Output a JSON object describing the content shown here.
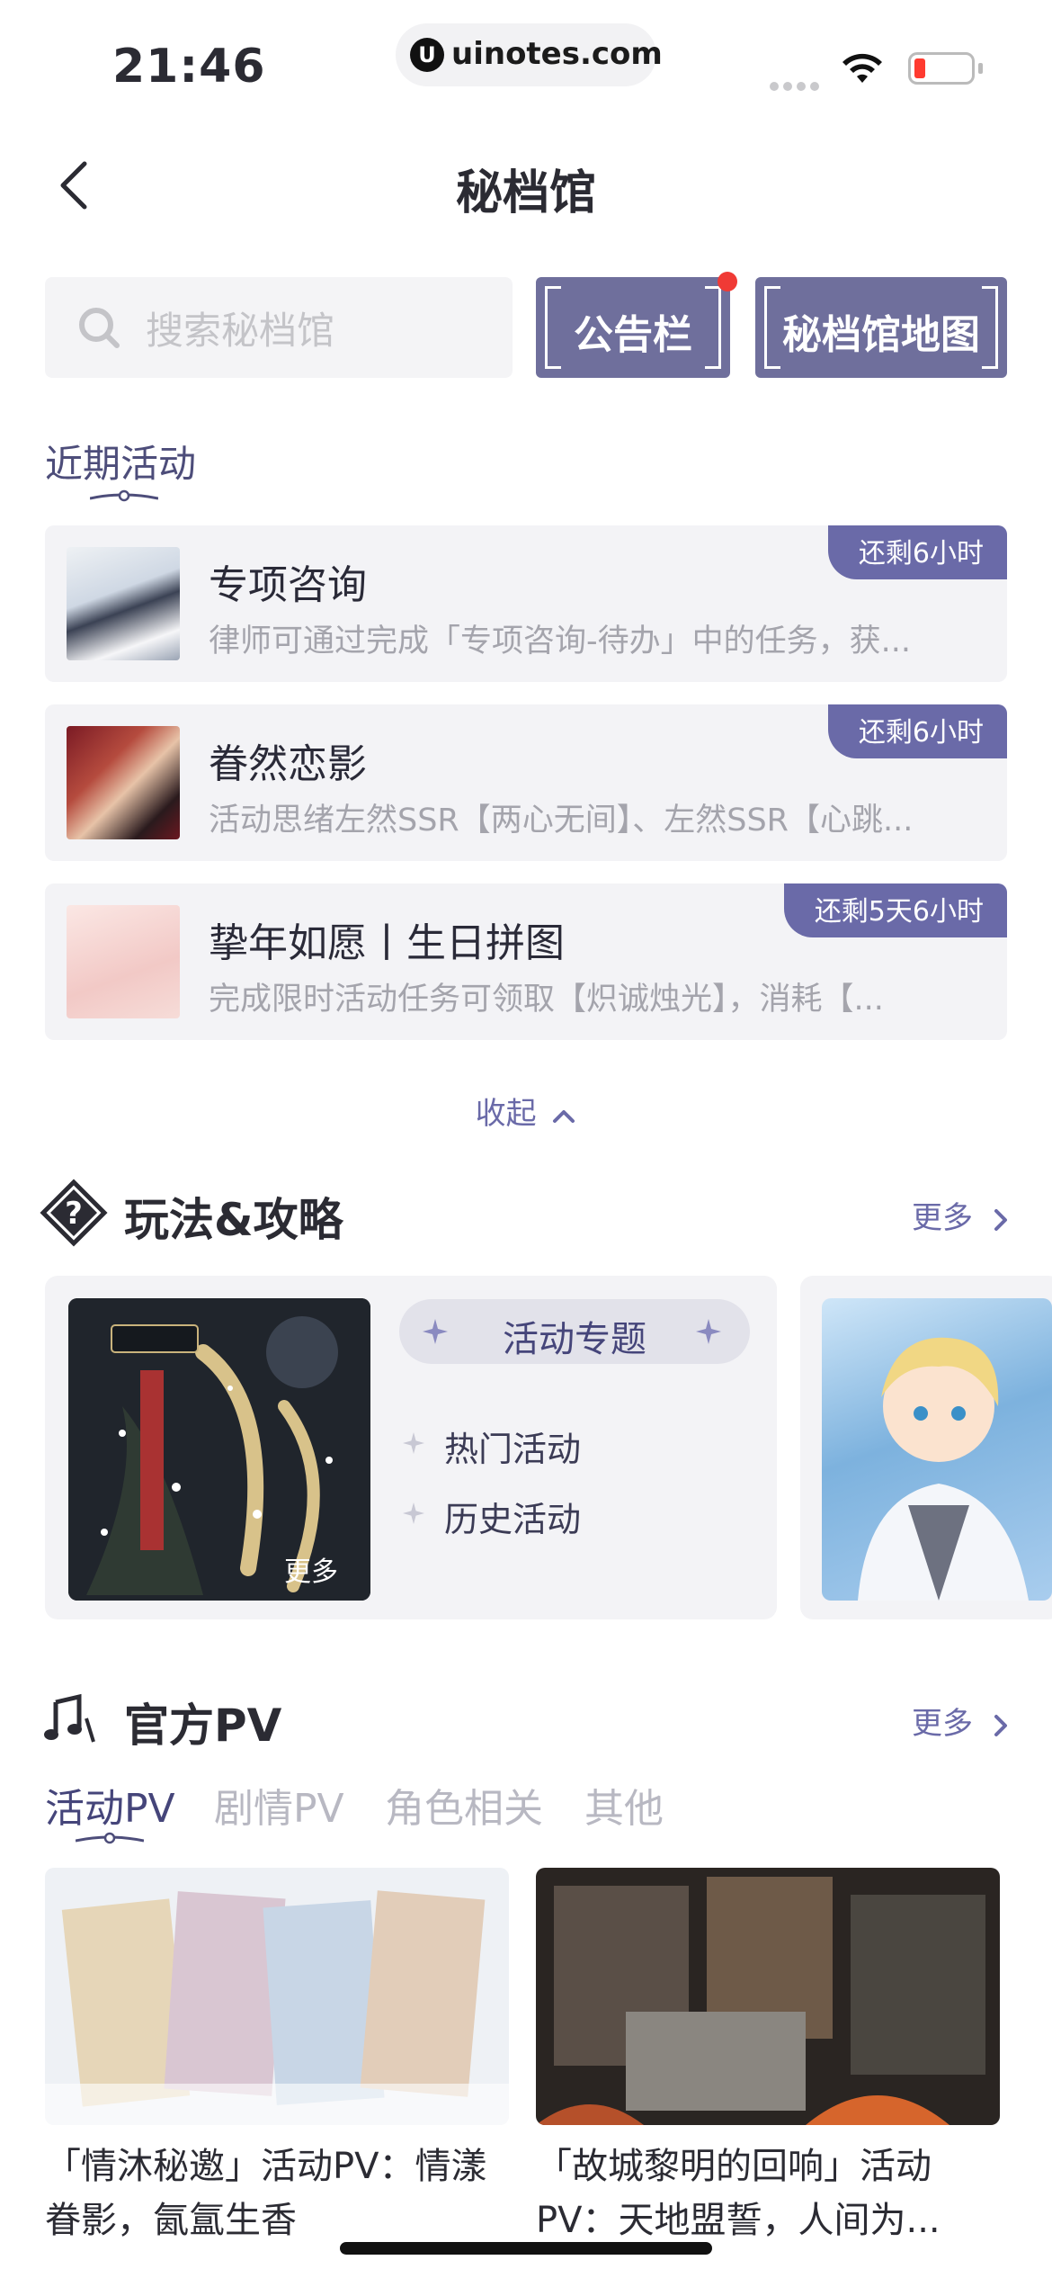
{
  "status_bar": {
    "time": "21:46",
    "url": "uinotes.com"
  },
  "header": {
    "title": "秘档馆"
  },
  "search": {
    "placeholder": "搜索秘档馆"
  },
  "buttons": {
    "notice": "公告栏",
    "map": "秘档馆地图"
  },
  "recent": {
    "heading": "近期活动",
    "items": [
      {
        "title": "专项咨询",
        "desc": "律师可通过完成「专项咨询-待办」中的任务，获...",
        "badge": "还剩6小时"
      },
      {
        "title": "眷然恋影",
        "desc": "活动思绪左然SSR【两心无间】、左然SSR【心跳...",
        "badge": "还剩6小时"
      },
      {
        "title": "挚年如愿丨生日拼图",
        "desc": "完成限时活动任务可领取【炽诚烛光】，消耗【...",
        "badge": "还剩5天6小时"
      }
    ],
    "collapse_label": "收起"
  },
  "gameplay": {
    "heading": "玩法&攻略",
    "more": "更多",
    "card": {
      "image_more": "更多",
      "pill": "活动专题",
      "links": [
        "热门活动",
        "历史活动"
      ]
    }
  },
  "pv": {
    "heading": "官方PV",
    "more": "更多",
    "tabs": [
      "活动PV",
      "剧情PV",
      "角色相关",
      "其他"
    ],
    "active_tab": 0,
    "videos": [
      {
        "caption": "「情沐秘邀」活动PV：情漾眷影，氤氲生香"
      },
      {
        "caption": "「故城黎明的回响」活动PV：天地盟誓，人间为..."
      }
    ]
  },
  "colors": {
    "accent": "#6a6aa8",
    "button_bg": "#6f6f9c",
    "dot": "#f03a35"
  },
  "icons": [
    "url-logo-icon",
    "wifi-icon",
    "battery-icon",
    "back-arrow-icon",
    "search-icon",
    "chevron-up-icon",
    "chevron-right-icon",
    "question-diamond-icon",
    "music-notes-icon",
    "sparkle-icon"
  ]
}
